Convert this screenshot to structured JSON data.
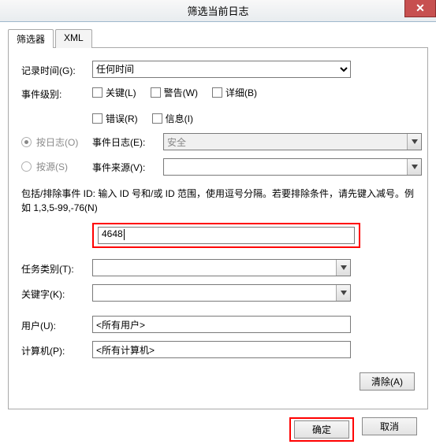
{
  "window": {
    "title": "筛选当前日志",
    "close_glyph": "✕"
  },
  "tabs": {
    "filter": "筛选器",
    "xml": "XML"
  },
  "labels": {
    "logged_time": "记录时间(G):",
    "event_level": "事件级别:",
    "by_log": "按日志(O)",
    "by_source": "按源(S)",
    "event_log": "事件日志(E):",
    "event_source": "事件来源(V):",
    "id_desc": "包括/排除事件 ID: 输入 ID 号和/或 ID 范围，使用逗号分隔。若要排除条件，请先键入减号。例如 1,3,5-99,-76(N)",
    "task_category": "任务类别(T):",
    "keywords": "关键字(K):",
    "user": "用户(U):",
    "computer": "计算机(P):"
  },
  "values": {
    "logged_time_selected": "任何时间",
    "event_log_value": "安全",
    "event_source_value": "",
    "event_id": "4648",
    "task_category_value": "",
    "keywords_value": "",
    "user_value": "<所有用户>",
    "computer_value": "<所有计算机>"
  },
  "checkboxes": {
    "critical": "关键(L)",
    "warning": "警告(W)",
    "verbose": "详细(B)",
    "error": "错误(R)",
    "info": "信息(I)"
  },
  "buttons": {
    "clear": "清除(A)",
    "ok": "确定",
    "cancel": "取消"
  }
}
